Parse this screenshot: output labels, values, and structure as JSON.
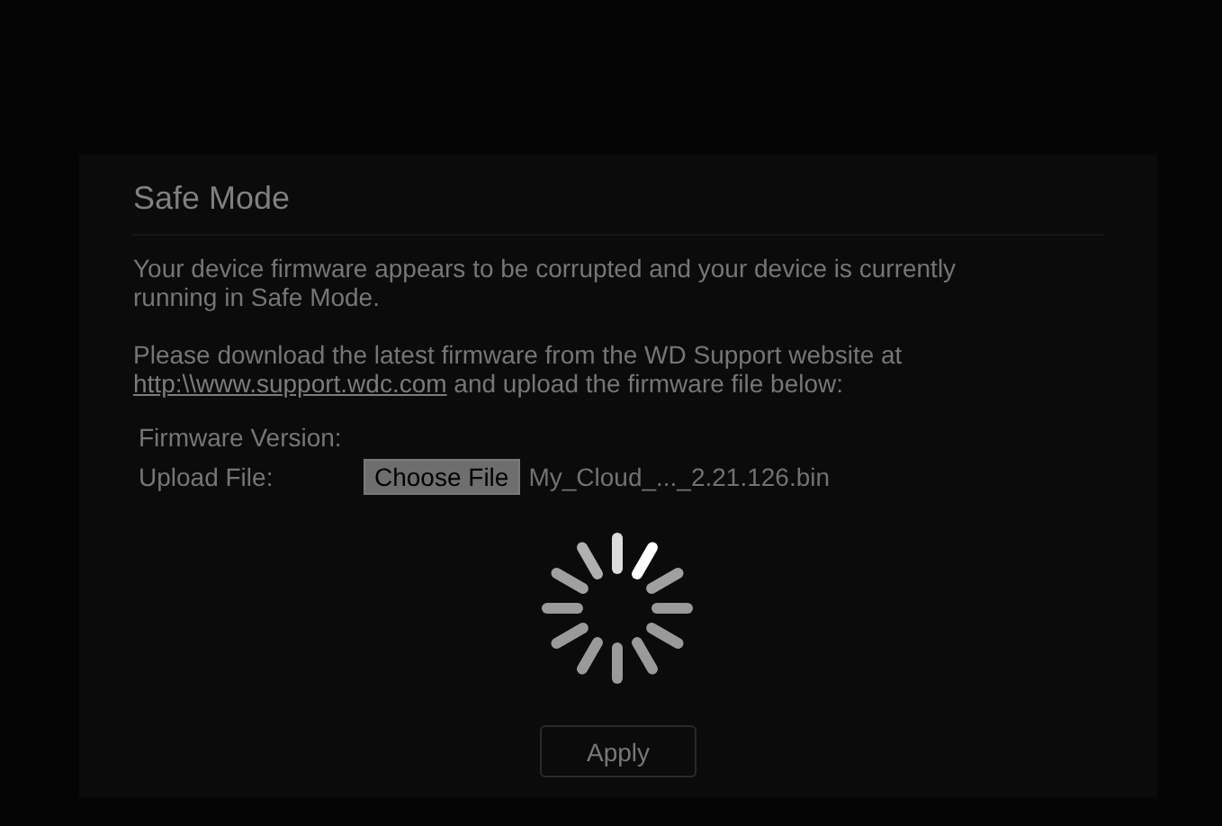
{
  "dialog": {
    "title": "Safe Mode",
    "message": "Your device firmware appears to be corrupted and your device is currently running in Safe Mode.",
    "instructions_before": "Please download the latest firmware from the WD Support website at",
    "link": "http:\\\\www.support.wdc.com",
    "instructions_after": "and upload the firmware file below:",
    "fields": [
      {
        "kind": "text",
        "label": "Firmware Version:"
      },
      {
        "kind": "file",
        "label": "Upload File:",
        "button": "Choose File",
        "value": "My_Cloud_..._2.21.126.bin"
      }
    ],
    "apply_button": "Apply"
  },
  "loading": true
}
